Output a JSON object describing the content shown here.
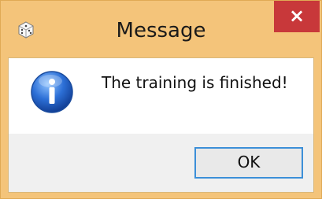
{
  "window": {
    "title": "Message",
    "close_glyph": "×"
  },
  "dialog": {
    "message": "The training is finished!",
    "ok_label": "OK"
  },
  "icons": {
    "app": "dice-icon",
    "message": "info-icon",
    "close": "close-icon"
  },
  "colors": {
    "frame": "#f4c47a",
    "close_button": "#c8383a",
    "button_focus_border": "#3c8fd8"
  }
}
